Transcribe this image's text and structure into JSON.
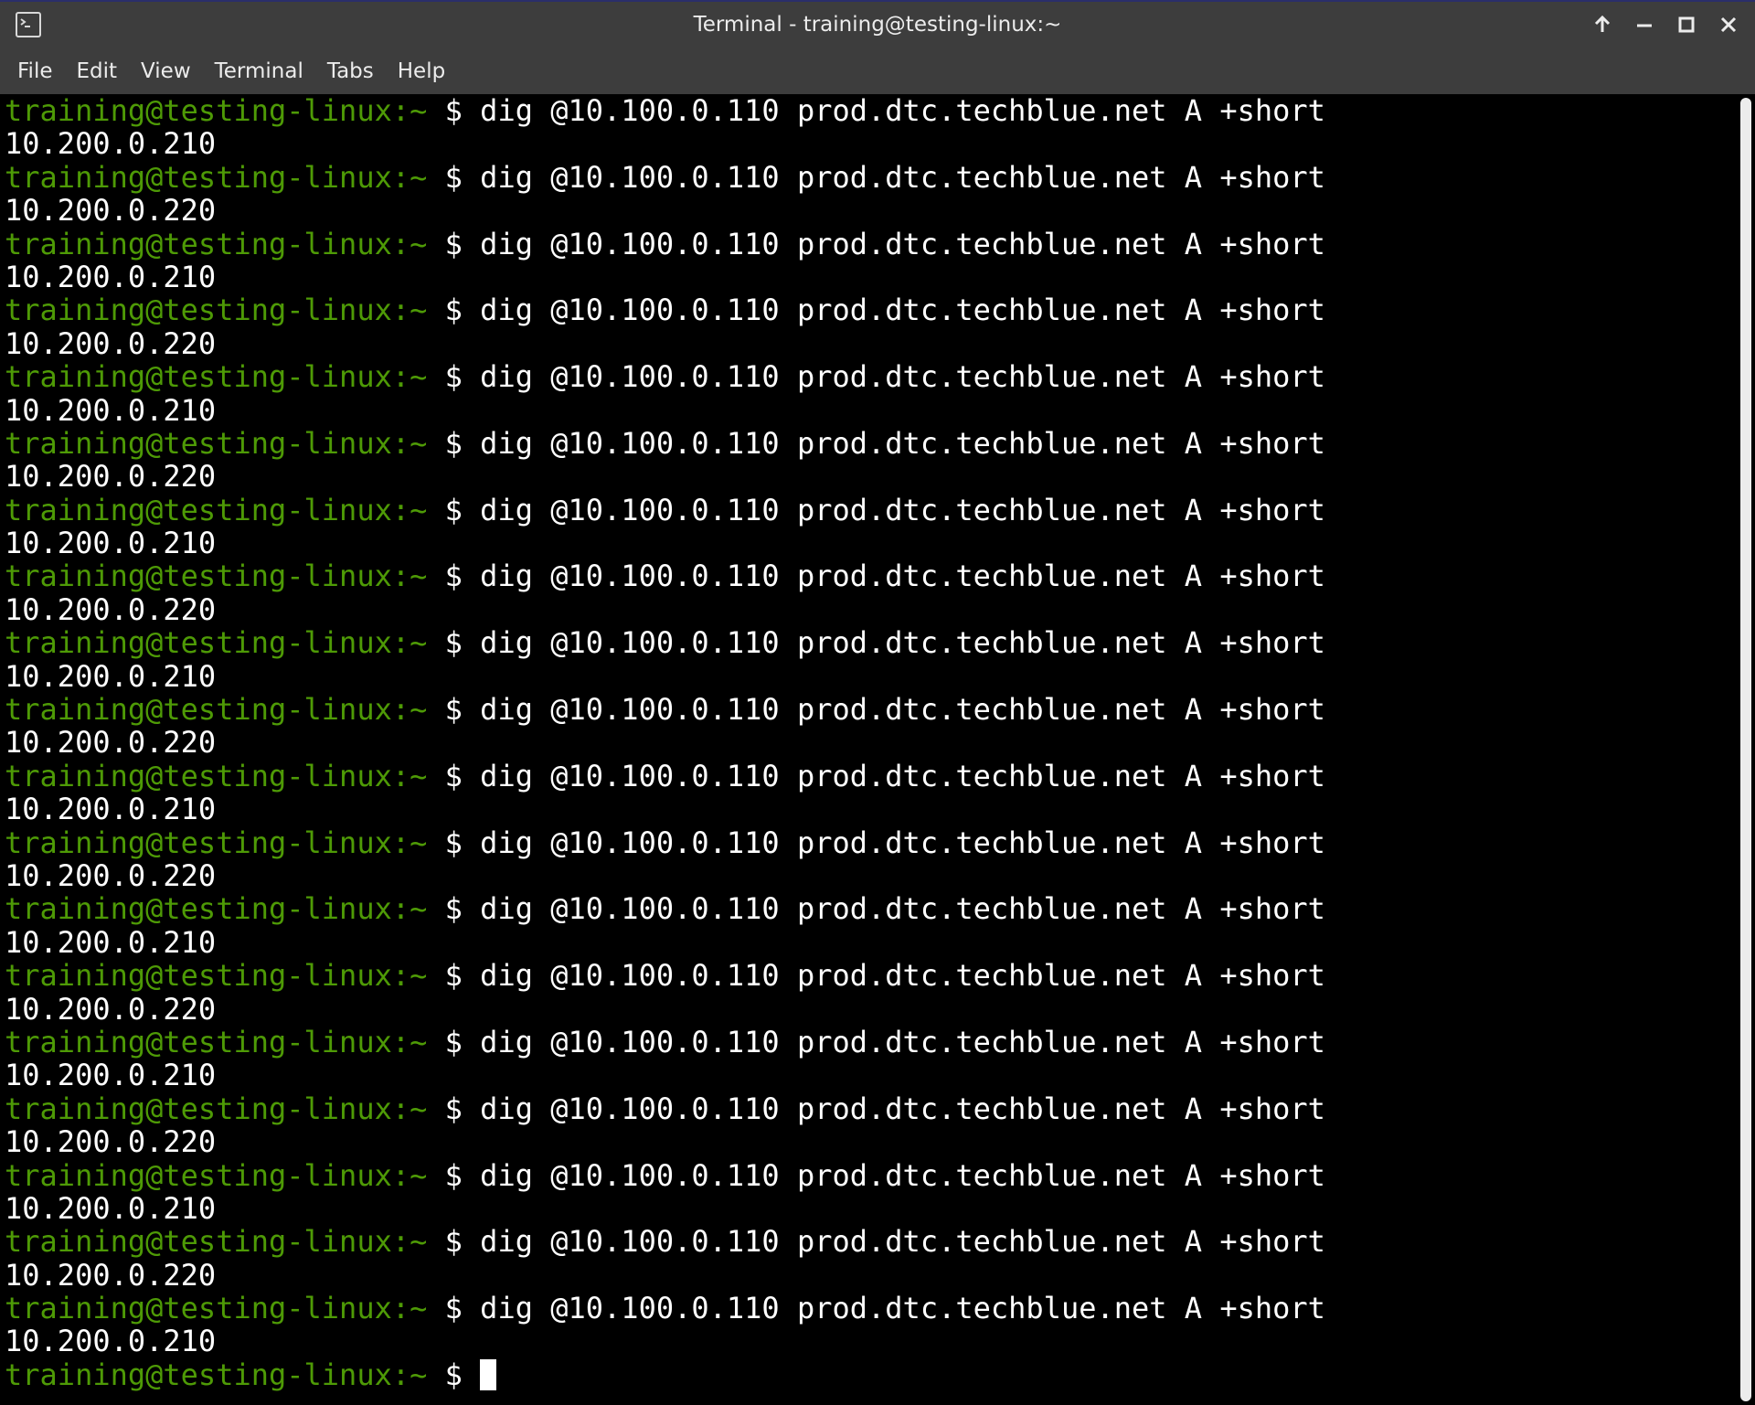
{
  "window": {
    "title": "Terminal - training@testing-linux:~"
  },
  "menu": {
    "items": [
      "File",
      "Edit",
      "View",
      "Terminal",
      "Tabs",
      "Help"
    ]
  },
  "icons": {
    "app": "terminal-app-icon",
    "keep_above": "arrow-up-icon",
    "minimize": "minimize-icon",
    "maximize": "maximize-icon",
    "close": "close-icon"
  },
  "colors": {
    "prompt": "#4e9a06",
    "text": "#ffffff",
    "background": "#000000",
    "chrome": "#3d3d3d"
  },
  "terminal": {
    "prompt_user": "training@testing-linux",
    "prompt_path": ":~",
    "prompt_symbol": "$",
    "entries": [
      {
        "command": "dig @10.100.0.110 prod.dtc.techblue.net A +short",
        "output": "10.200.0.210"
      },
      {
        "command": "dig @10.100.0.110 prod.dtc.techblue.net A +short",
        "output": "10.200.0.220"
      },
      {
        "command": "dig @10.100.0.110 prod.dtc.techblue.net A +short",
        "output": "10.200.0.210"
      },
      {
        "command": "dig @10.100.0.110 prod.dtc.techblue.net A +short",
        "output": "10.200.0.220"
      },
      {
        "command": "dig @10.100.0.110 prod.dtc.techblue.net A +short",
        "output": "10.200.0.210"
      },
      {
        "command": "dig @10.100.0.110 prod.dtc.techblue.net A +short",
        "output": "10.200.0.220"
      },
      {
        "command": "dig @10.100.0.110 prod.dtc.techblue.net A +short",
        "output": "10.200.0.210"
      },
      {
        "command": "dig @10.100.0.110 prod.dtc.techblue.net A +short",
        "output": "10.200.0.220"
      },
      {
        "command": "dig @10.100.0.110 prod.dtc.techblue.net A +short",
        "output": "10.200.0.210"
      },
      {
        "command": "dig @10.100.0.110 prod.dtc.techblue.net A +short",
        "output": "10.200.0.220"
      },
      {
        "command": "dig @10.100.0.110 prod.dtc.techblue.net A +short",
        "output": "10.200.0.210"
      },
      {
        "command": "dig @10.100.0.110 prod.dtc.techblue.net A +short",
        "output": "10.200.0.220"
      },
      {
        "command": "dig @10.100.0.110 prod.dtc.techblue.net A +short",
        "output": "10.200.0.210"
      },
      {
        "command": "dig @10.100.0.110 prod.dtc.techblue.net A +short",
        "output": "10.200.0.220"
      },
      {
        "command": "dig @10.100.0.110 prod.dtc.techblue.net A +short",
        "output": "10.200.0.210"
      },
      {
        "command": "dig @10.100.0.110 prod.dtc.techblue.net A +short",
        "output": "10.200.0.220"
      },
      {
        "command": "dig @10.100.0.110 prod.dtc.techblue.net A +short",
        "output": "10.200.0.210"
      },
      {
        "command": "dig @10.100.0.110 prod.dtc.techblue.net A +short",
        "output": "10.200.0.220"
      },
      {
        "command": "dig @10.100.0.110 prod.dtc.techblue.net A +short",
        "output": "10.200.0.210"
      }
    ],
    "current_input": ""
  }
}
